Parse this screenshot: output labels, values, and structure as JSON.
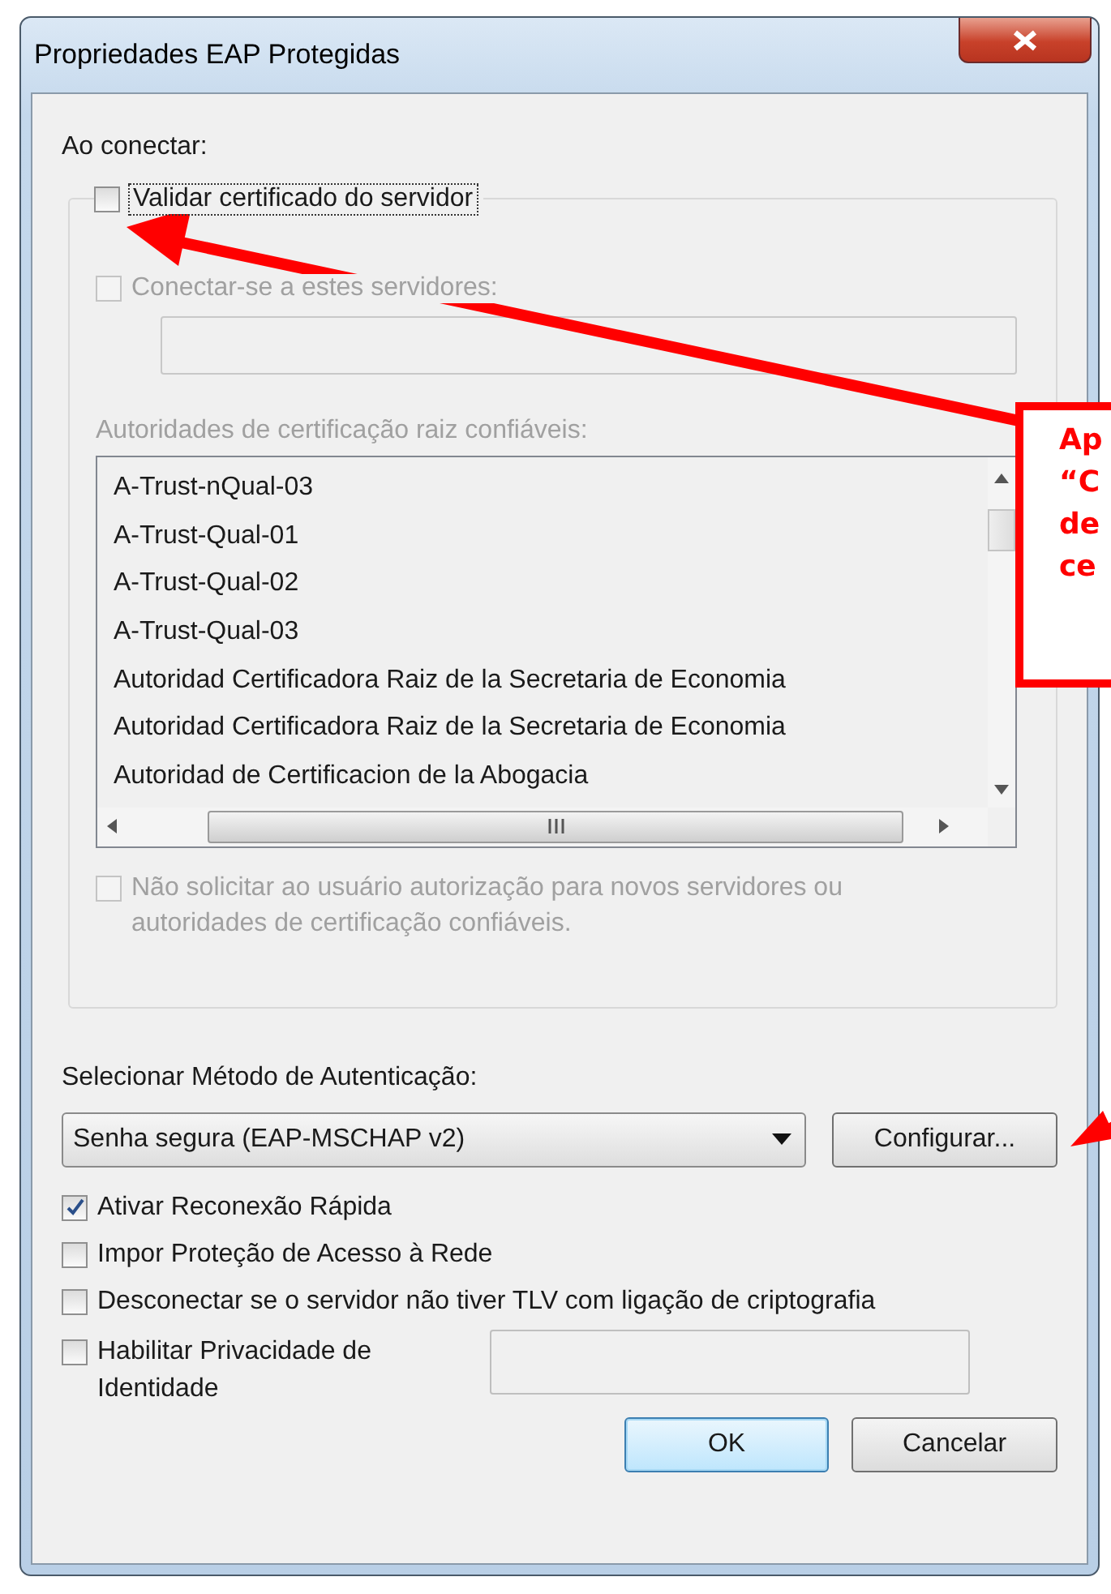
{
  "window": {
    "title": "Propriedades EAP Protegidas"
  },
  "on_connect": {
    "label": "Ao conectar:"
  },
  "validate_certificate": {
    "label": "Validar certificado do servidor",
    "checked": false,
    "disabled": false
  },
  "connect_to_servers": {
    "label": "Conectar-se a estes servidores:",
    "checked": false,
    "disabled": true
  },
  "trusted_roots": {
    "label": "Autoridades de certificação raiz confiáveis:",
    "disabled": true,
    "items": [
      {
        "label": "A-Trust-nQual-03"
      },
      {
        "label": "A-Trust-Qual-01"
      },
      {
        "label": "A-Trust-Qual-02"
      },
      {
        "label": "A-Trust-Qual-03"
      },
      {
        "label": "Autoridad Certificadora Raiz de la Secretaria de Economia"
      },
      {
        "label": "Autoridad Certificadora Raiz de la Secretaria de Economia"
      },
      {
        "label": "Autoridad de Certificacion de la Abogacia"
      }
    ]
  },
  "no_prompt": {
    "label": "Não solicitar ao usuário autorização para novos servidores ou autoridades de certificação confiáveis.",
    "checked": false,
    "disabled": true
  },
  "auth_method": {
    "label": "Selecionar Método de Autenticação:",
    "value": "Senha segura (EAP-MSCHAP v2)"
  },
  "configure_button": {
    "label": "Configurar..."
  },
  "options": [
    {
      "label": "Ativar Reconexão Rápida",
      "checked": true
    },
    {
      "label": "Impor Proteção de Acesso à Rede",
      "checked": false
    },
    {
      "label": "Desconectar se o servidor não tiver TLV com ligação de criptografia",
      "checked": false
    }
  ],
  "identity_privacy": {
    "label": "Habilitar Privacidade de Identidade",
    "checked": false
  },
  "buttons": [
    {
      "label": "OK",
      "default": true
    },
    {
      "label": "Cancelar",
      "default": false
    }
  ],
  "annotation": {
    "lines": [
      "Ap",
      "“C",
      "de",
      "ce"
    ]
  }
}
